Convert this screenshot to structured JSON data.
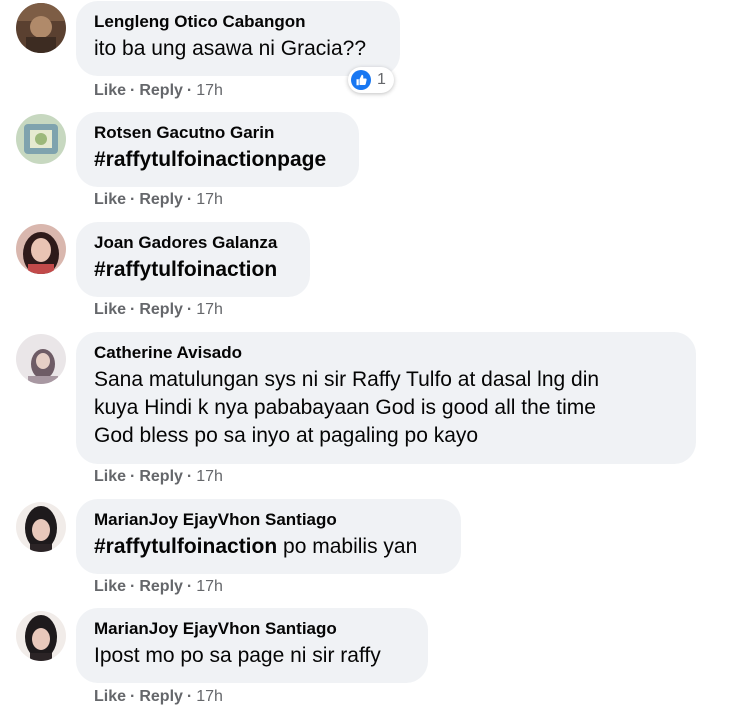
{
  "comments": [
    {
      "author": "Lengleng Otico Cabangon",
      "text": "ito ba ung asawa ni Gracia??",
      "like": "Like",
      "reply": "Reply",
      "time": "17h",
      "reaction_count": "1",
      "reaction_icon": "like-icon",
      "avatar_colors": [
        "#6b4a3a",
        "#a07a5c",
        "#3d2c22"
      ]
    },
    {
      "author": "Rotsen Gacutno Garin",
      "hashtag": "#raffytulfoinactionpage",
      "text": "",
      "like": "Like",
      "reply": "Reply",
      "time": "17h",
      "avatar_colors": [
        "#8fb3b8",
        "#c9d9b0",
        "#6e8f9e"
      ]
    },
    {
      "author": "Joan Gadores Galanza",
      "hashtag": "#raffytulfoinaction",
      "text": "",
      "like": "Like",
      "reply": "Reply",
      "time": "17h",
      "avatar_colors": [
        "#c48a86",
        "#3a2222",
        "#e8c2b6"
      ]
    },
    {
      "author": "Catherine Avisado",
      "lines": [
        "Sana matulungan sys ni sir Raffy Tulfo at dasal lng din",
        "kuya Hindi k nya pababayaan God is good all the time",
        "God bless po sa inyo at pagaling po kayo"
      ],
      "like": "Like",
      "reply": "Reply",
      "time": "17h",
      "avatar_colors": [
        "#d9d4d8",
        "#9a8a93",
        "#f2eef0"
      ]
    },
    {
      "author": "MarianJoy EjayVhon Santiago",
      "hashtag": "#raffytulfoinaction",
      "text": " po mabilis yan",
      "like": "Like",
      "reply": "Reply",
      "time": "17h",
      "avatar_colors": [
        "#1c1a1c",
        "#e3c3b6",
        "#3b2e2e"
      ]
    },
    {
      "author": "MarianJoy EjayVhon Santiago",
      "text": "Ipost mo po sa page ni sir raffy",
      "like": "Like",
      "reply": "Reply",
      "time": "17h",
      "avatar_colors": [
        "#1c1a1c",
        "#e3c3b6",
        "#3b2e2e"
      ]
    }
  ],
  "separator": "·"
}
